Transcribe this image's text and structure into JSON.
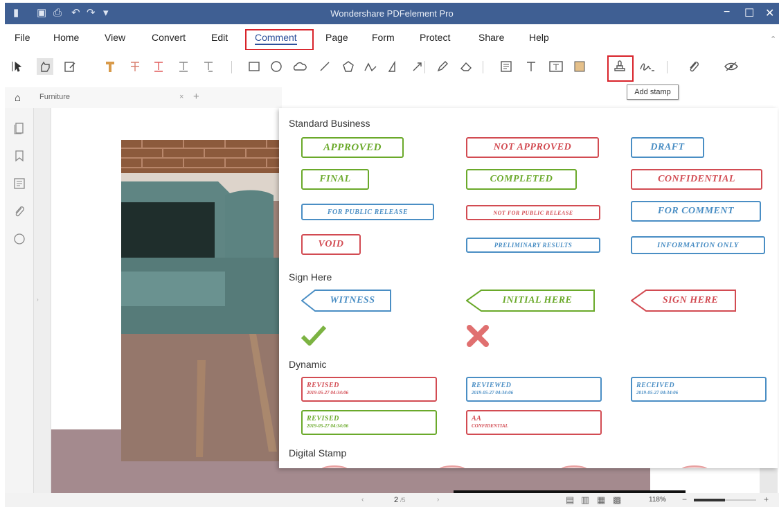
{
  "app": {
    "title": "Wondershare PDFelement Pro"
  },
  "menu": [
    "File",
    "Home",
    "View",
    "Convert",
    "Edit",
    "Comment",
    "Page",
    "Form",
    "Protect",
    "Share",
    "Help"
  ],
  "active_menu": "Comment",
  "tab": {
    "name": "Furniture",
    "close": "×",
    "add": "+"
  },
  "tooltip": "Add stamp",
  "sections": {
    "standard": "Standard Business",
    "sign": "Sign Here",
    "dynamic": "Dynamic",
    "digital": "Digital Stamp"
  },
  "stamps_standard": [
    "APPROVED",
    "NOT APPROVED",
    "DRAFT",
    "FINAL",
    "COMPLETED",
    "CONFIDENTIAL",
    "FOR PUBLIC RELEASE",
    "NOT FOR PUBLIC RELEASE",
    "FOR COMMENT",
    "VOID",
    "PRELIMINARY RESULTS",
    "INFORMATION ONLY"
  ],
  "stamps_sign": [
    "WITNESS",
    "INITIAL HERE",
    "SIGN HERE"
  ],
  "stamps_dynamic": [
    {
      "title": "REVISED",
      "date": "2019-05-27 04:34:06"
    },
    {
      "title": "REVIEWED",
      "date": "2019-05-27 04:34:06"
    },
    {
      "title": "RECEIVED",
      "date": "2019-05-27 04:34:06"
    },
    {
      "title": "REVISED",
      "date": "2019-05-27 04:34:06"
    },
    {
      "title": "AA",
      "date": "CONFIDENTIAL"
    }
  ],
  "colors": {
    "green": "#6aa92a",
    "red": "#d24b52",
    "blue": "#4a8ec4",
    "title_bar": "#3f5f93",
    "highlight": "#d8232a"
  },
  "status": {
    "prev": "‹",
    "next": "›",
    "page": "2",
    "total": "/5",
    "zoom": "118%",
    "minus": "−",
    "plus": "+"
  }
}
